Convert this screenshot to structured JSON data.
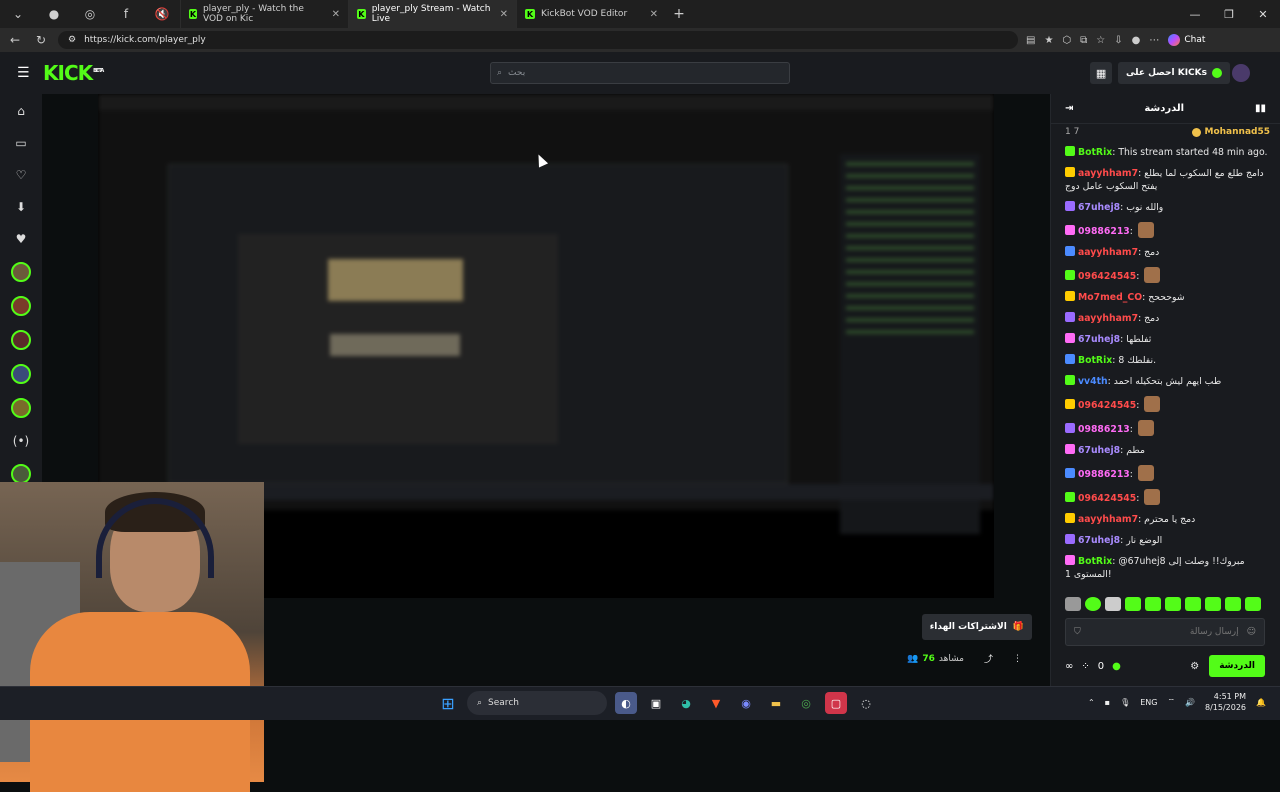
{
  "browser": {
    "tabs": [
      {
        "title": "player_ply - Watch the VOD on Kic",
        "active": false
      },
      {
        "title": "player_ply Stream - Watch Live",
        "active": true
      },
      {
        "title": "KickBot VOD Editor",
        "active": false
      }
    ],
    "url": "https://kick.com/player_ply",
    "chat_label": "Chat"
  },
  "header": {
    "logo": "KICK",
    "logo_badge": "BETA",
    "search_placeholder": "بحث",
    "kicks_button": "احصل على KICKs"
  },
  "below_video": {
    "subs_button": "الاشتراكات الهداء",
    "viewers_count": "76",
    "viewers_label": "مشاهد"
  },
  "chat": {
    "title": "الدردشة",
    "pinned_count": "1 7",
    "pinned_user": "Mohannad55",
    "messages": [
      {
        "user": "BotRix",
        "color": "#53fc18",
        "text": "This stream started 48 min ago."
      },
      {
        "user": "aayyhham7",
        "color": "#ff4b4b",
        "text": "دامج طلع مع السكوب لما يطلع يفتح السكوب عامل دوج"
      },
      {
        "user": "67uhej8",
        "color": "#a98bff",
        "text": "والله نوب"
      },
      {
        "user": "09886213",
        "color": "#ff6bf5",
        "text": ""
      },
      {
        "user": "aayyhham7",
        "color": "#ff4b4b",
        "text": "دمج"
      },
      {
        "user": "096424545",
        "color": "#ff4b4b",
        "text": ""
      },
      {
        "user": "Mo7med_CO",
        "color": "#ff4b4b",
        "text": "شوحححح"
      },
      {
        "user": "aayyhham7",
        "color": "#ff4b4b",
        "text": "دمج"
      },
      {
        "user": "67uhej8",
        "color": "#a98bff",
        "text": "ثفلطها"
      },
      {
        "user": "BotRix",
        "color": "#53fc18",
        "text": "نفلطك 8."
      },
      {
        "user": "vv4th",
        "color": "#4b8bff",
        "text": "طب ايهم ليش بتحكيله احمد"
      },
      {
        "user": "096424545",
        "color": "#ff4b4b",
        "text": ""
      },
      {
        "user": "09886213",
        "color": "#ff6bf5",
        "text": ""
      },
      {
        "user": "67uhej8",
        "color": "#a98bff",
        "text": "مطم"
      },
      {
        "user": "09886213",
        "color": "#ff6bf5",
        "text": ""
      },
      {
        "user": "096424545",
        "color": "#ff4b4b",
        "text": ""
      },
      {
        "user": "aayyhham7",
        "color": "#ff4b4b",
        "text": "دمج يا محترم"
      },
      {
        "user": "67uhej8",
        "color": "#a98bff",
        "text": "الوضع نار"
      },
      {
        "user": "BotRix",
        "color": "#53fc18",
        "text": "@67uhej8 مبروك!! وصلت إلى المستوى 1!"
      }
    ],
    "input_placeholder": "إرسال رسالة",
    "kick_points": "0",
    "send_label": "الدردشة"
  },
  "taskbar": {
    "search_label": "Search",
    "lang": "ENG",
    "time": "4:51 PM",
    "date": "8/15/2026"
  },
  "colors": {
    "kick_green": "#53fc18",
    "panel_bg": "#191b1f",
    "page_bg": "#0b0e0f"
  }
}
